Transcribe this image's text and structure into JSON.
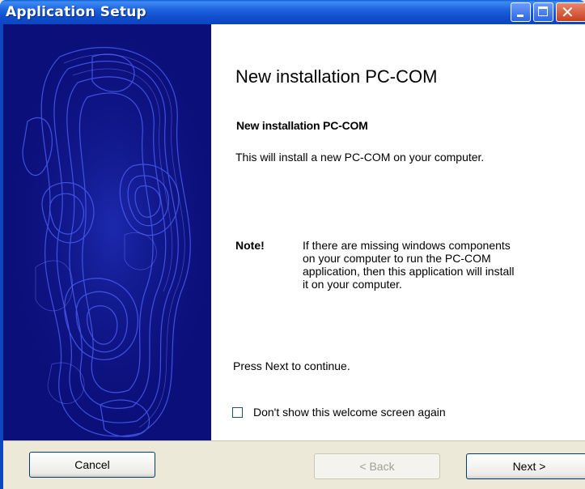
{
  "window": {
    "title": "Application Setup",
    "controls": {
      "minimize": "minimize-icon",
      "maximize": "maximize-icon",
      "close": "close-icon"
    }
  },
  "content": {
    "heading": "New installation PC-COM",
    "subheading": "New installation PC-COM",
    "description": "This will install a new PC-COM on your computer.",
    "note_label": "Note!",
    "note_text": "If there are missing windows components on your computer to run the PC-COM application, then this application will install it on your computer.",
    "press_next": "Press Next to continue.",
    "checkbox_label": "Don't show this welcome screen again",
    "checkbox_checked": false
  },
  "buttons": {
    "cancel": "Cancel",
    "back": "< Back",
    "next": "Next >"
  },
  "colors": {
    "art_background": "#0B0F7A",
    "art_lines": "#3F4FE6",
    "titlebar": "#0F4FCF",
    "dialog_face": "#ECE9D8"
  }
}
